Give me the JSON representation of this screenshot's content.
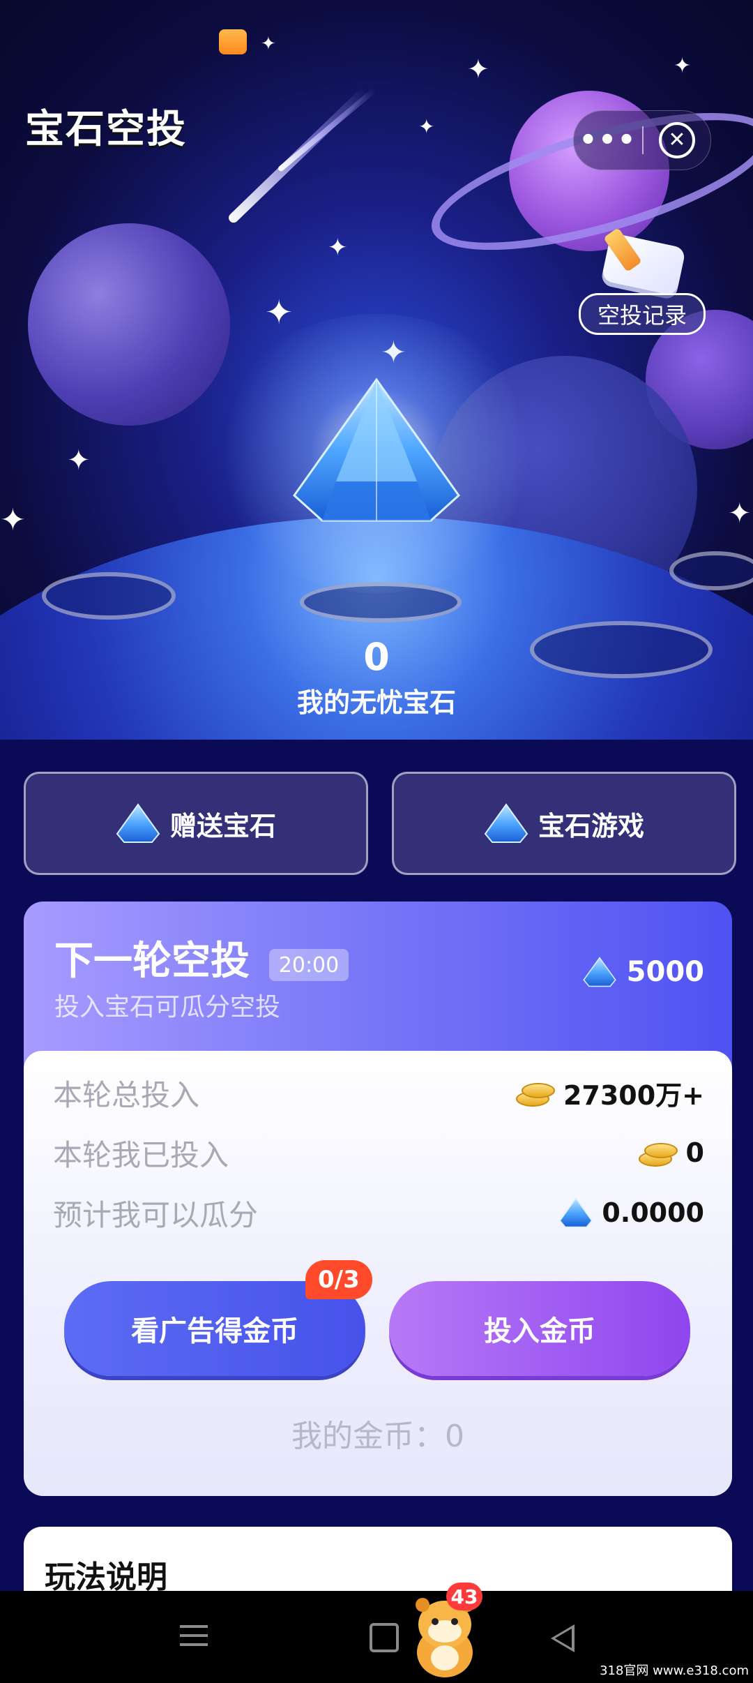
{
  "header": {
    "title": "宝石空投",
    "more_label": "•••",
    "close_label": "✕",
    "record_label": "空投记录"
  },
  "gems": {
    "count": "0",
    "label": "我的无忧宝石"
  },
  "actions": {
    "gift_label": "赠送宝石",
    "game_label": "宝石游戏"
  },
  "airdrop": {
    "title": "下一轮空投",
    "timer": "20:00",
    "subtitle": "投入宝石可瓜分空投",
    "reward": "5000",
    "rows": [
      {
        "label": "本轮总投入",
        "value": "27300万+"
      },
      {
        "label": "本轮我已投入",
        "value": "0"
      },
      {
        "label": "预计我可以瓜分",
        "value": "0.0000"
      }
    ],
    "ad_button": "看广告得金币",
    "ad_badge": "0/3",
    "invest_button": "投入金币",
    "my_coins": "我的金币：0"
  },
  "rules": {
    "title": "玩法说明"
  },
  "nav": {
    "pet_badge": "43"
  },
  "watermark": "318官网 www.e318.com",
  "colors": {
    "background": "#0b0a57",
    "accent_blue": "#4652ea",
    "accent_purple": "#8f46ee",
    "badge_red": "#ff4a2b"
  }
}
